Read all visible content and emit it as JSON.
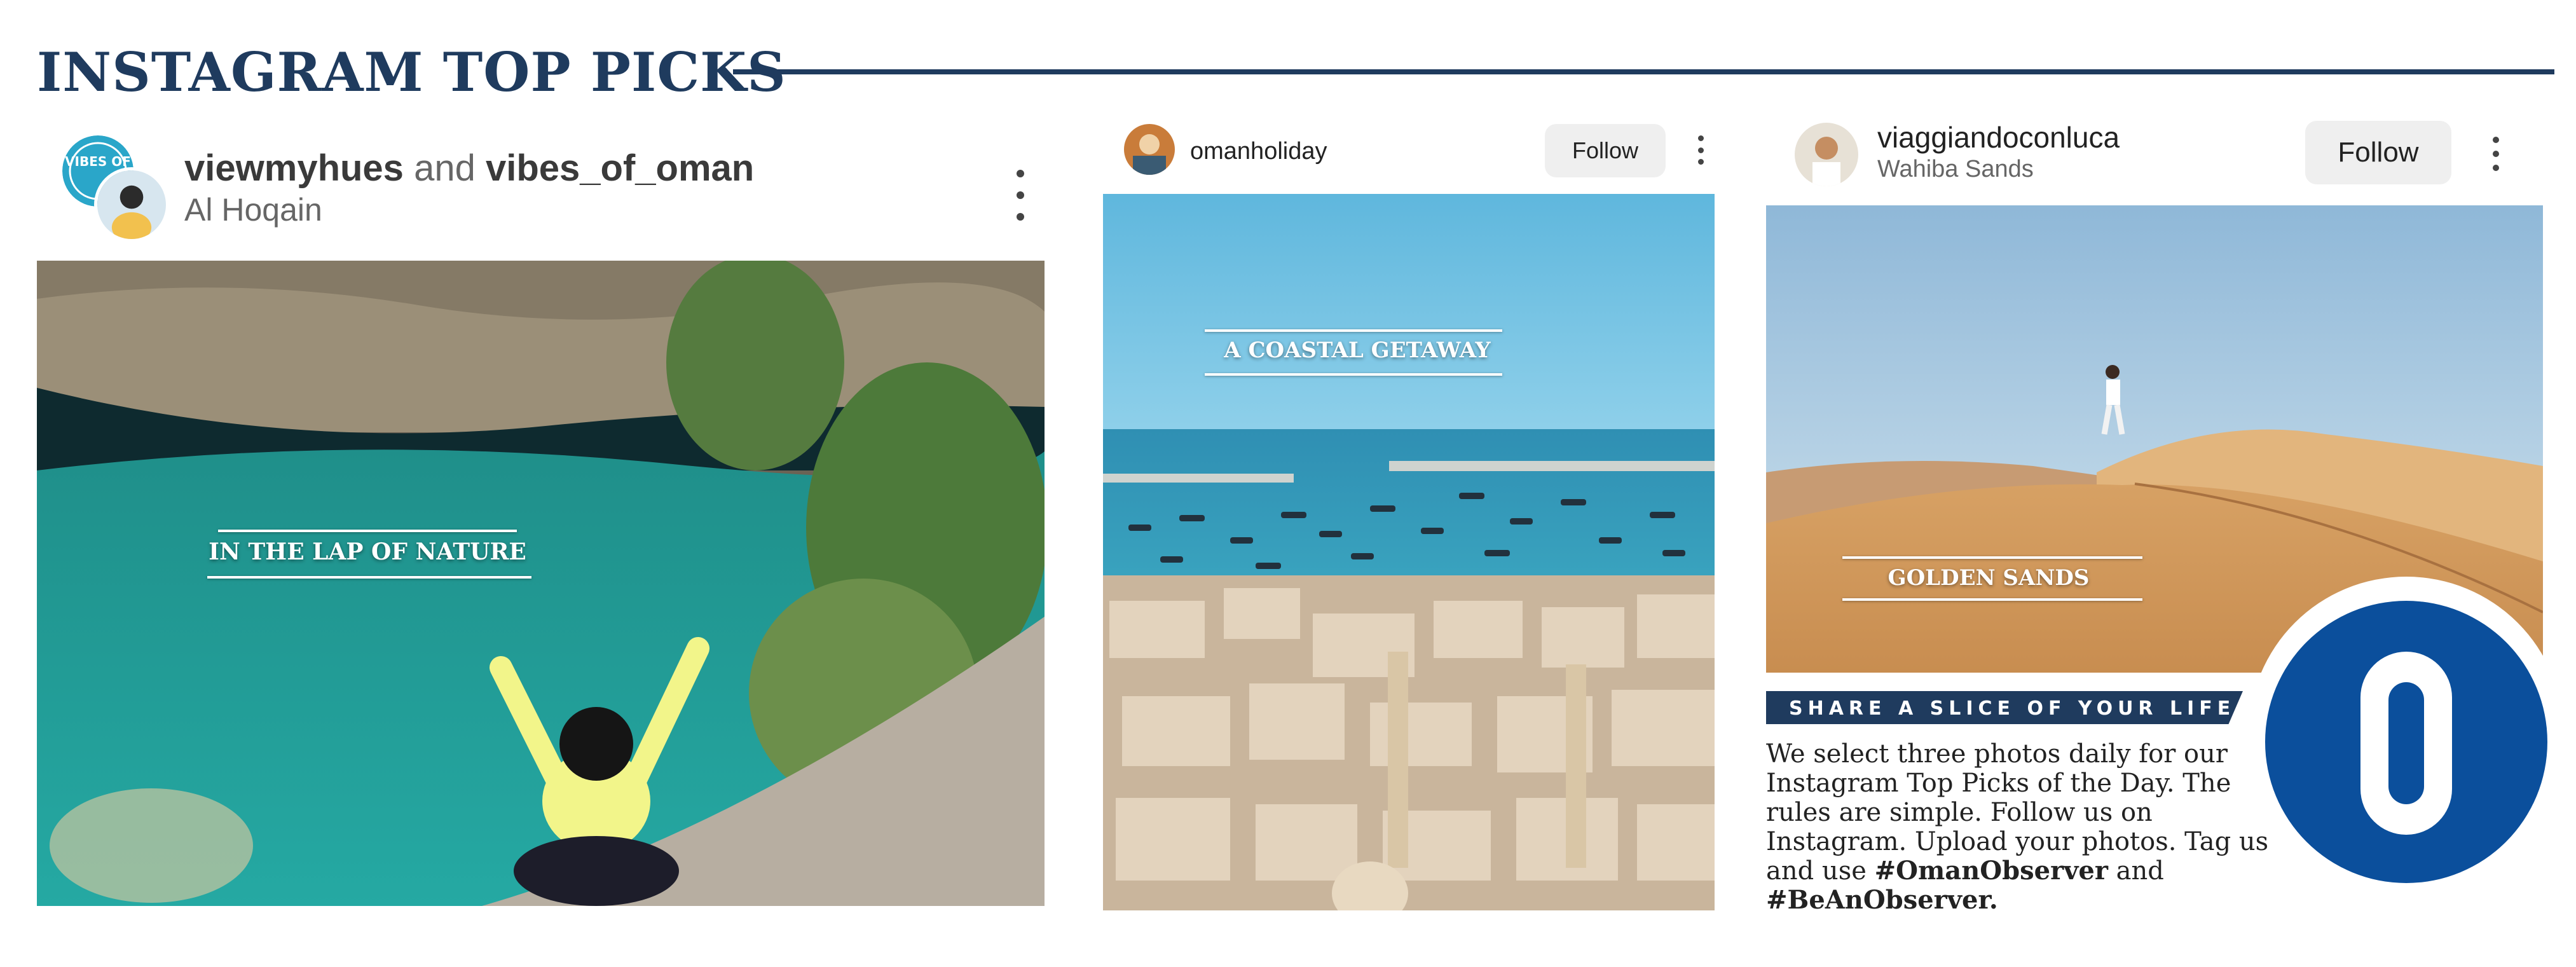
{
  "header": {
    "title": "INSTAGRAM TOP PICKS"
  },
  "posts": [
    {
      "user1": "viewmyhues",
      "joiner": "and",
      "user2": "vibes_of_oman",
      "location": "Al Hoqain",
      "caption": "IN THE LAP OF NATURE",
      "avatar_badge": "VIBES OF"
    },
    {
      "user": "omanholiday",
      "follow_label": "Follow",
      "caption": "A COASTAL GETAWAY"
    },
    {
      "user": "viaggiandoconluca",
      "location": "Wahiba Sands",
      "follow_label": "Follow",
      "caption": "GOLDEN SANDS"
    }
  ],
  "promo": {
    "banner": "SHARE A SLICE OF YOUR LIFE",
    "text_1": "We select three photos daily for our Instagram Top Picks of the Day. The rules are simple. Follow us on Instagram. Upload your photos. Tag us and use",
    "hashtag_1": "#OmanObserver",
    "text_2": "and",
    "hashtag_2": "#BeAnObserver.",
    "logo_letter": "O"
  },
  "colors": {
    "navy": "#1f3b5e",
    "logo_blue": "#0b4f9c",
    "follow_bg": "#efefef"
  }
}
